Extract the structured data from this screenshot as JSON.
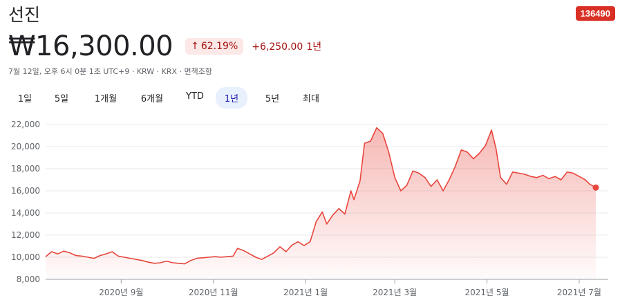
{
  "header": {
    "name": "선진",
    "ticker": "136490",
    "price": "₩16,300.00",
    "percent_change": "62.19%",
    "absolute_change": "+6,250.00",
    "period": "1년",
    "meta": "7월 12일, 오후 6시 0분 1초 UTC+9 · KRW · KRX · 면책조항"
  },
  "tabs": [
    {
      "label": "1일",
      "active": false
    },
    {
      "label": "5일",
      "active": false
    },
    {
      "label": "1개월",
      "active": false
    },
    {
      "label": "6개월",
      "active": false
    },
    {
      "label": "YTD",
      "active": false
    },
    {
      "label": "1년",
      "active": true
    },
    {
      "label": "5년",
      "active": false
    },
    {
      "label": "최대",
      "active": false
    }
  ],
  "colors": {
    "line": "#e8453c",
    "accent": "#d93025",
    "badge_bg": "#fce8e6",
    "badge_text": "#a50e0e"
  },
  "icons": {
    "change_arrow": "arrow-up-icon"
  },
  "chart_data": {
    "type": "area",
    "ylim": [
      8000,
      22000
    ],
    "y_ticks": [
      8000,
      10000,
      12000,
      14000,
      16000,
      18000,
      20000,
      22000
    ],
    "y_tick_labels": [
      "8,000",
      "10,000",
      "12,000",
      "14,000",
      "16,000",
      "18,000",
      "20,000",
      "22,000"
    ],
    "x_tick_labels": [
      "2020년 9월",
      "2020년 11월",
      "2021년 1월",
      "2021년 3월",
      "2021년 5월",
      "2021년 7월"
    ],
    "x_tick_dates": [
      "2020-09-01",
      "2020-11-01",
      "2021-01-01",
      "2021-03-01",
      "2021-05-01",
      "2021-07-01"
    ],
    "x_range": [
      "2020-07-13",
      "2021-07-12"
    ],
    "grid": true,
    "series": [
      {
        "points": [
          [
            "2020-07-13",
            10050
          ],
          [
            "2020-07-17",
            10500
          ],
          [
            "2020-07-21",
            10300
          ],
          [
            "2020-07-25",
            10550
          ],
          [
            "2020-07-29",
            10400
          ],
          [
            "2020-08-02",
            10150
          ],
          [
            "2020-08-06",
            10100
          ],
          [
            "2020-08-10",
            10000
          ],
          [
            "2020-08-14",
            9900
          ],
          [
            "2020-08-18",
            10150
          ],
          [
            "2020-08-22",
            10300
          ],
          [
            "2020-08-26",
            10500
          ],
          [
            "2020-08-30",
            10100
          ],
          [
            "2020-09-03",
            10000
          ],
          [
            "2020-09-07",
            9900
          ],
          [
            "2020-09-11",
            9800
          ],
          [
            "2020-09-15",
            9700
          ],
          [
            "2020-09-19",
            9550
          ],
          [
            "2020-09-23",
            9450
          ],
          [
            "2020-09-27",
            9500
          ],
          [
            "2020-10-01",
            9650
          ],
          [
            "2020-10-05",
            9500
          ],
          [
            "2020-10-09",
            9450
          ],
          [
            "2020-10-13",
            9400
          ],
          [
            "2020-10-17",
            9700
          ],
          [
            "2020-10-21",
            9900
          ],
          [
            "2020-10-25",
            9950
          ],
          [
            "2020-10-29",
            10000
          ],
          [
            "2020-11-02",
            10050
          ],
          [
            "2020-11-06",
            10000
          ],
          [
            "2020-11-10",
            10050
          ],
          [
            "2020-11-14",
            10100
          ],
          [
            "2020-11-17",
            10800
          ],
          [
            "2020-11-21",
            10600
          ],
          [
            "2020-11-25",
            10300
          ],
          [
            "2020-11-29",
            10000
          ],
          [
            "2020-12-03",
            9800
          ],
          [
            "2020-12-07",
            10100
          ],
          [
            "2020-12-11",
            10400
          ],
          [
            "2020-12-15",
            10950
          ],
          [
            "2020-12-19",
            10500
          ],
          [
            "2020-12-23",
            11100
          ],
          [
            "2020-12-27",
            11400
          ],
          [
            "2020-12-31",
            11050
          ],
          [
            "2021-01-04",
            11400
          ],
          [
            "2021-01-08",
            13200
          ],
          [
            "2021-01-12",
            14100
          ],
          [
            "2021-01-15",
            13000
          ],
          [
            "2021-01-19",
            13800
          ],
          [
            "2021-01-23",
            14400
          ],
          [
            "2021-01-27",
            13900
          ],
          [
            "2021-01-31",
            16000
          ],
          [
            "2021-02-02",
            15200
          ],
          [
            "2021-02-06",
            16900
          ],
          [
            "2021-02-09",
            20300
          ],
          [
            "2021-02-13",
            20500
          ],
          [
            "2021-02-17",
            21700
          ],
          [
            "2021-02-21",
            21200
          ],
          [
            "2021-02-25",
            19500
          ],
          [
            "2021-03-01",
            17200
          ],
          [
            "2021-03-05",
            16000
          ],
          [
            "2021-03-09",
            16500
          ],
          [
            "2021-03-13",
            17800
          ],
          [
            "2021-03-17",
            17600
          ],
          [
            "2021-03-21",
            17200
          ],
          [
            "2021-03-25",
            16400
          ],
          [
            "2021-03-29",
            17000
          ],
          [
            "2021-04-02",
            16000
          ],
          [
            "2021-04-06",
            17000
          ],
          [
            "2021-04-10",
            18200
          ],
          [
            "2021-04-14",
            19700
          ],
          [
            "2021-04-18",
            19500
          ],
          [
            "2021-04-22",
            18900
          ],
          [
            "2021-04-26",
            19400
          ],
          [
            "2021-04-30",
            20100
          ],
          [
            "2021-05-04",
            21500
          ],
          [
            "2021-05-07",
            19800
          ],
          [
            "2021-05-10",
            17200
          ],
          [
            "2021-05-14",
            16600
          ],
          [
            "2021-05-18",
            17700
          ],
          [
            "2021-05-22",
            17600
          ],
          [
            "2021-05-26",
            17500
          ],
          [
            "2021-05-30",
            17300
          ],
          [
            "2021-06-03",
            17200
          ],
          [
            "2021-06-07",
            17400
          ],
          [
            "2021-06-11",
            17100
          ],
          [
            "2021-06-15",
            17300
          ],
          [
            "2021-06-19",
            17000
          ],
          [
            "2021-06-23",
            17700
          ],
          [
            "2021-06-27",
            17600
          ],
          [
            "2021-07-01",
            17300
          ],
          [
            "2021-07-05",
            17000
          ],
          [
            "2021-07-08",
            16600
          ],
          [
            "2021-07-12",
            16300
          ]
        ]
      }
    ]
  }
}
